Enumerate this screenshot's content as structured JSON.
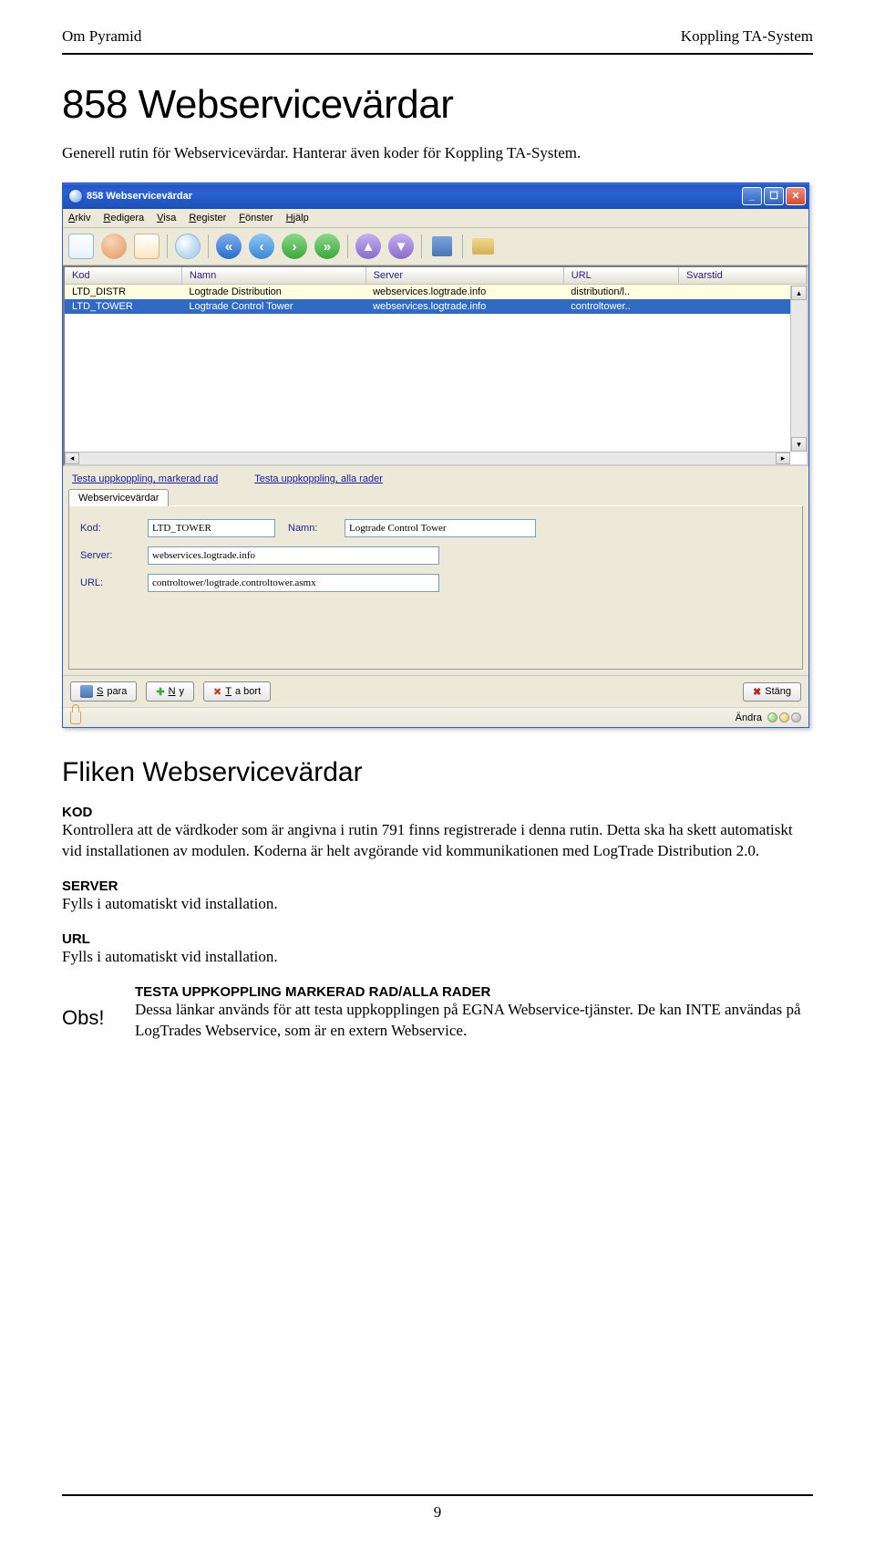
{
  "header": {
    "left": "Om Pyramid",
    "right": "Koppling TA-System"
  },
  "page_title": "858 Webservicevärdar",
  "intro": "Generell rutin för Webservicevärdar. Hanterar även koder för Koppling TA-System.",
  "window": {
    "title": "858 Webservicevärdar",
    "menus": [
      {
        "u": "A",
        "rest": "rkiv"
      },
      {
        "u": "R",
        "rest": "edigera"
      },
      {
        "u": "V",
        "rest": "isa"
      },
      {
        "u": "R",
        "rest": "egister"
      },
      {
        "u": "F",
        "rest": "önster"
      },
      {
        "u": "H",
        "rest": "jälp"
      }
    ],
    "columns": [
      "Kod",
      "Namn",
      "Server",
      "URL",
      "Svarstid"
    ],
    "rows": [
      {
        "kod": "LTD_DISTR",
        "namn": "Logtrade Distribution",
        "server": "webservices.logtrade.info",
        "url": "distribution/l..",
        "svarstid": ""
      },
      {
        "kod": "LTD_TOWER",
        "namn": "Logtrade Control Tower",
        "server": "webservices.logtrade.info",
        "url": "controltower..",
        "svarstid": ""
      }
    ],
    "links": {
      "test_marked": "Testa uppkoppling, markerad rad",
      "test_all": "Testa uppkoppling, alla  rader"
    },
    "tab_label": "Webservicevärdar",
    "form": {
      "kod_label": "Kod:",
      "kod_value": "LTD_TOWER",
      "namn_label": "Namn:",
      "namn_value": "Logtrade Control Tower",
      "server_label": "Server:",
      "server_value": "webservices.logtrade.info",
      "url_label": "URL:",
      "url_value": "controltower/logtrade.controltower.asmx"
    },
    "buttons": {
      "spara": "Spara",
      "ny": "Ny",
      "tabort": "Ta bort",
      "stang": "Stäng"
    },
    "status": {
      "andra": "Ändra"
    }
  },
  "section_title": "Fliken Webservicevärdar",
  "kod": {
    "label": "KOD",
    "text": "Kontrollera att de värdkoder som är angivna i rutin 791 finns registrerade i denna rutin. Detta ska ha skett automatiskt vid installationen av modulen. Koderna är helt avgörande vid kommunikationen med LogTrade Distribution 2.0."
  },
  "server": {
    "label": "SERVER",
    "text": "Fylls i automatiskt vid installation."
  },
  "url": {
    "label": "URL",
    "text": "Fylls i automatiskt vid installation."
  },
  "obs": {
    "label": "Obs!",
    "heading": "TESTA UPPKOPPLING MARKERAD RAD/ALLA RADER",
    "text": "Dessa länkar används för att testa uppkopplingen på EGNA Webservice-tjänster. De kan INTE användas på LogTrades Webservice, som är en extern Webservice."
  },
  "page_number": "9"
}
